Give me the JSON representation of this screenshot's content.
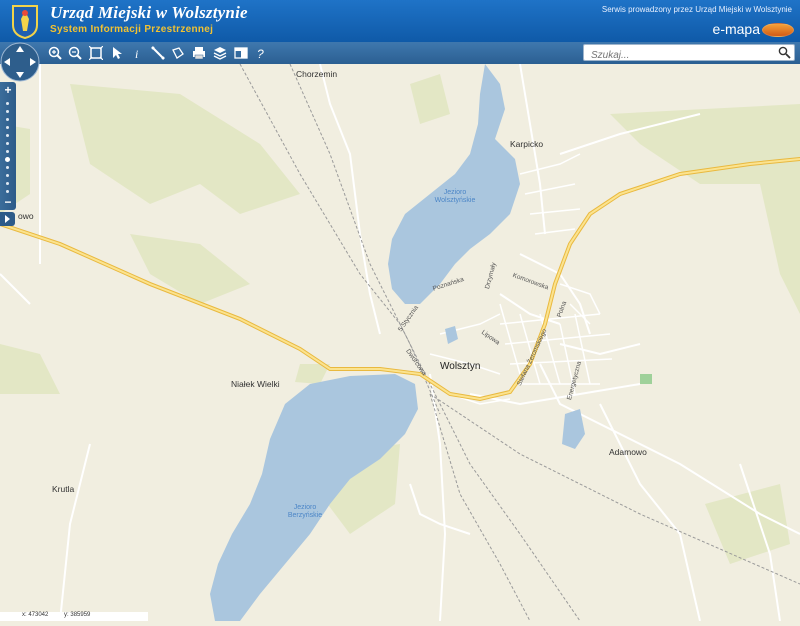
{
  "header": {
    "title": "Urząd Miejski w Wolsztynie",
    "subtitle": "System Informacji Przestrzennej",
    "service_text": "Serwis prowadzony przez Urząd Miejski w Wolsztynie",
    "brand": "e-mapa",
    "colors": {
      "bar": "#1565b8",
      "subtitle": "#f1c232"
    }
  },
  "toolbar": {
    "tools": [
      "zoom-in-icon",
      "zoom-out-icon",
      "full-extent-icon",
      "select-icon",
      "info-icon",
      "measure-distance-icon",
      "measure-area-icon",
      "print-icon",
      "layers-icon",
      "layout-icon",
      "help-icon"
    ]
  },
  "search": {
    "placeholder": "Szukaj..."
  },
  "map": {
    "places": {
      "chorzemin": "Chorzemin",
      "karpicko": "Karpicko",
      "wolsztyn": "Wolsztyn",
      "nialek": "Niałek Wielki",
      "adamowo": "Adamowo",
      "krutla": "Krutla",
      "edge_west": "owo"
    },
    "lakes": {
      "north_1": "Jezioro",
      "north_2": "Wolsztyńskie",
      "south_1": "Jezioro",
      "south_2": "Berzyńskie"
    },
    "streets": {
      "poznanska": "Poznańska",
      "drzymaly": "Drzymały",
      "komorowska": "Komorowska",
      "stycznia": "5 Stycznia",
      "lipowa": "Lipowa",
      "zeromskiego": "Stefana Żeromskiego",
      "dworcowa": "Dworcowa",
      "polna": "Polna",
      "energetyczna": "Energetyczna"
    },
    "colors": {
      "land": "#f1eee0",
      "forest": "#e4e7c6",
      "water": "#a9c5dc",
      "road_main": "#f5c94d",
      "road_minor": "#ffffff",
      "rail": "#9a9a9a"
    }
  },
  "coords": {
    "x": "x: 473042",
    "y": "y: 385959"
  }
}
